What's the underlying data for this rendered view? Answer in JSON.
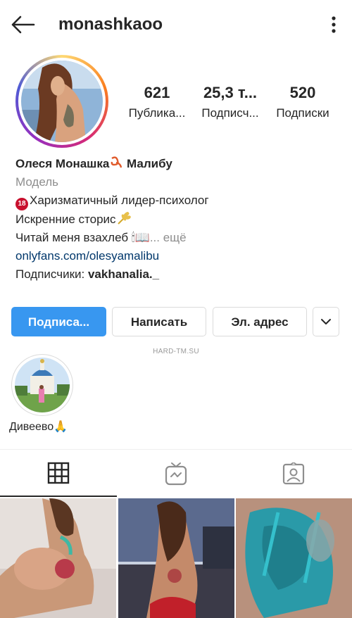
{
  "header": {
    "username": "monashkaoo"
  },
  "stats": [
    {
      "value": "621",
      "label": "Публика..."
    },
    {
      "value": "25,3 т...",
      "label": "Подписч..."
    },
    {
      "value": "520",
      "label": "Подписки"
    }
  ],
  "bio": {
    "name": "Олеся Монашка",
    "name_suffix": " Малибу",
    "category": "Модель",
    "line1_badge": "18",
    "line1": "Харизматичный лидер-психолог",
    "line2": "Искренние сторис",
    "line3": "Читай меня взахлеб",
    "line3_emoji": "🕯📖",
    "more_dots": "...",
    "more": " ещё",
    "link": "onlyfans.com/olesyamalibu",
    "followers_prefix": "Подписчики: ",
    "followers_name": "vakhanalia._"
  },
  "buttons": {
    "follow": "Подписа...",
    "message": "Написать",
    "email": "Эл. адрес"
  },
  "watermark": "HARD-TM.SU",
  "highlights": [
    {
      "label": "Дивеево🙏"
    }
  ],
  "tabs": [
    "grid",
    "igtv",
    "tagged"
  ],
  "colors": {
    "primary_button": "#3897f0",
    "link": "#00376b",
    "secondary_text": "#8e8e8e"
  }
}
